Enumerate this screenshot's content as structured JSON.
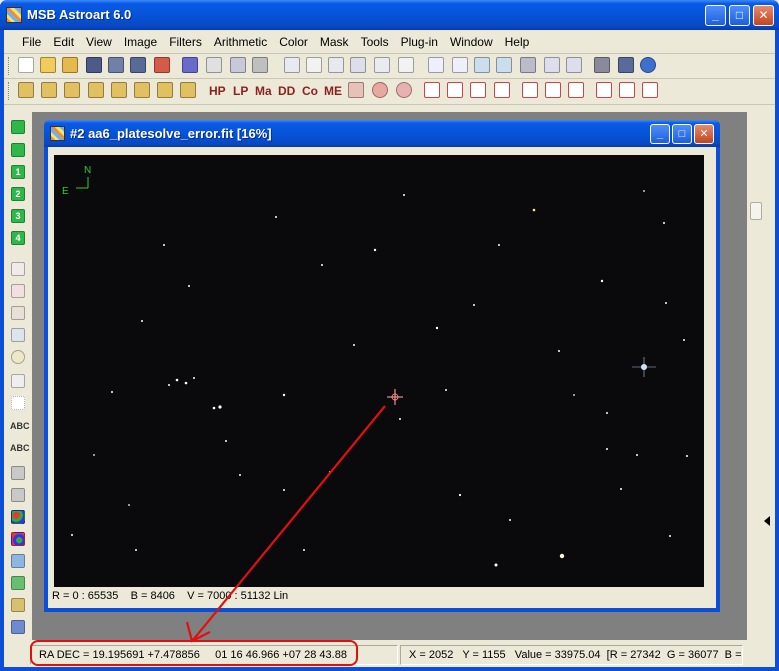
{
  "window": {
    "title": "MSB Astroart 6.0"
  },
  "menu": [
    "File",
    "Edit",
    "View",
    "Image",
    "Filters",
    "Arithmetic",
    "Color",
    "Mask",
    "Tools",
    "Plug-in",
    "Window",
    "Help"
  ],
  "toolbar2_labels": [
    "HP",
    "LP",
    "Ma",
    "DD",
    "Co",
    "ME"
  ],
  "left_toolbar": {
    "numbers": [
      "1",
      "2",
      "3",
      "4"
    ],
    "text_tools": [
      "ABC",
      "ABC"
    ]
  },
  "child": {
    "title": "#2 aa6_platesolve_error.fit  [16%]",
    "compass": {
      "north": "N",
      "east": "E"
    },
    "status": "R = 0 : 65535    B = 8406    V = 7000 : 51132 Lin"
  },
  "statusbar": {
    "radec": "RA DEC = 19.195691 +7.478856     01 16 46.966 +07 28 43.88",
    "pixel": "X = 2052   Y = 1155   Value = 33975.04  [R = 27342  G = 36077  B = "
  },
  "colors": {
    "annotation": "#e01010",
    "xp_blue": "#0a4fd6"
  }
}
